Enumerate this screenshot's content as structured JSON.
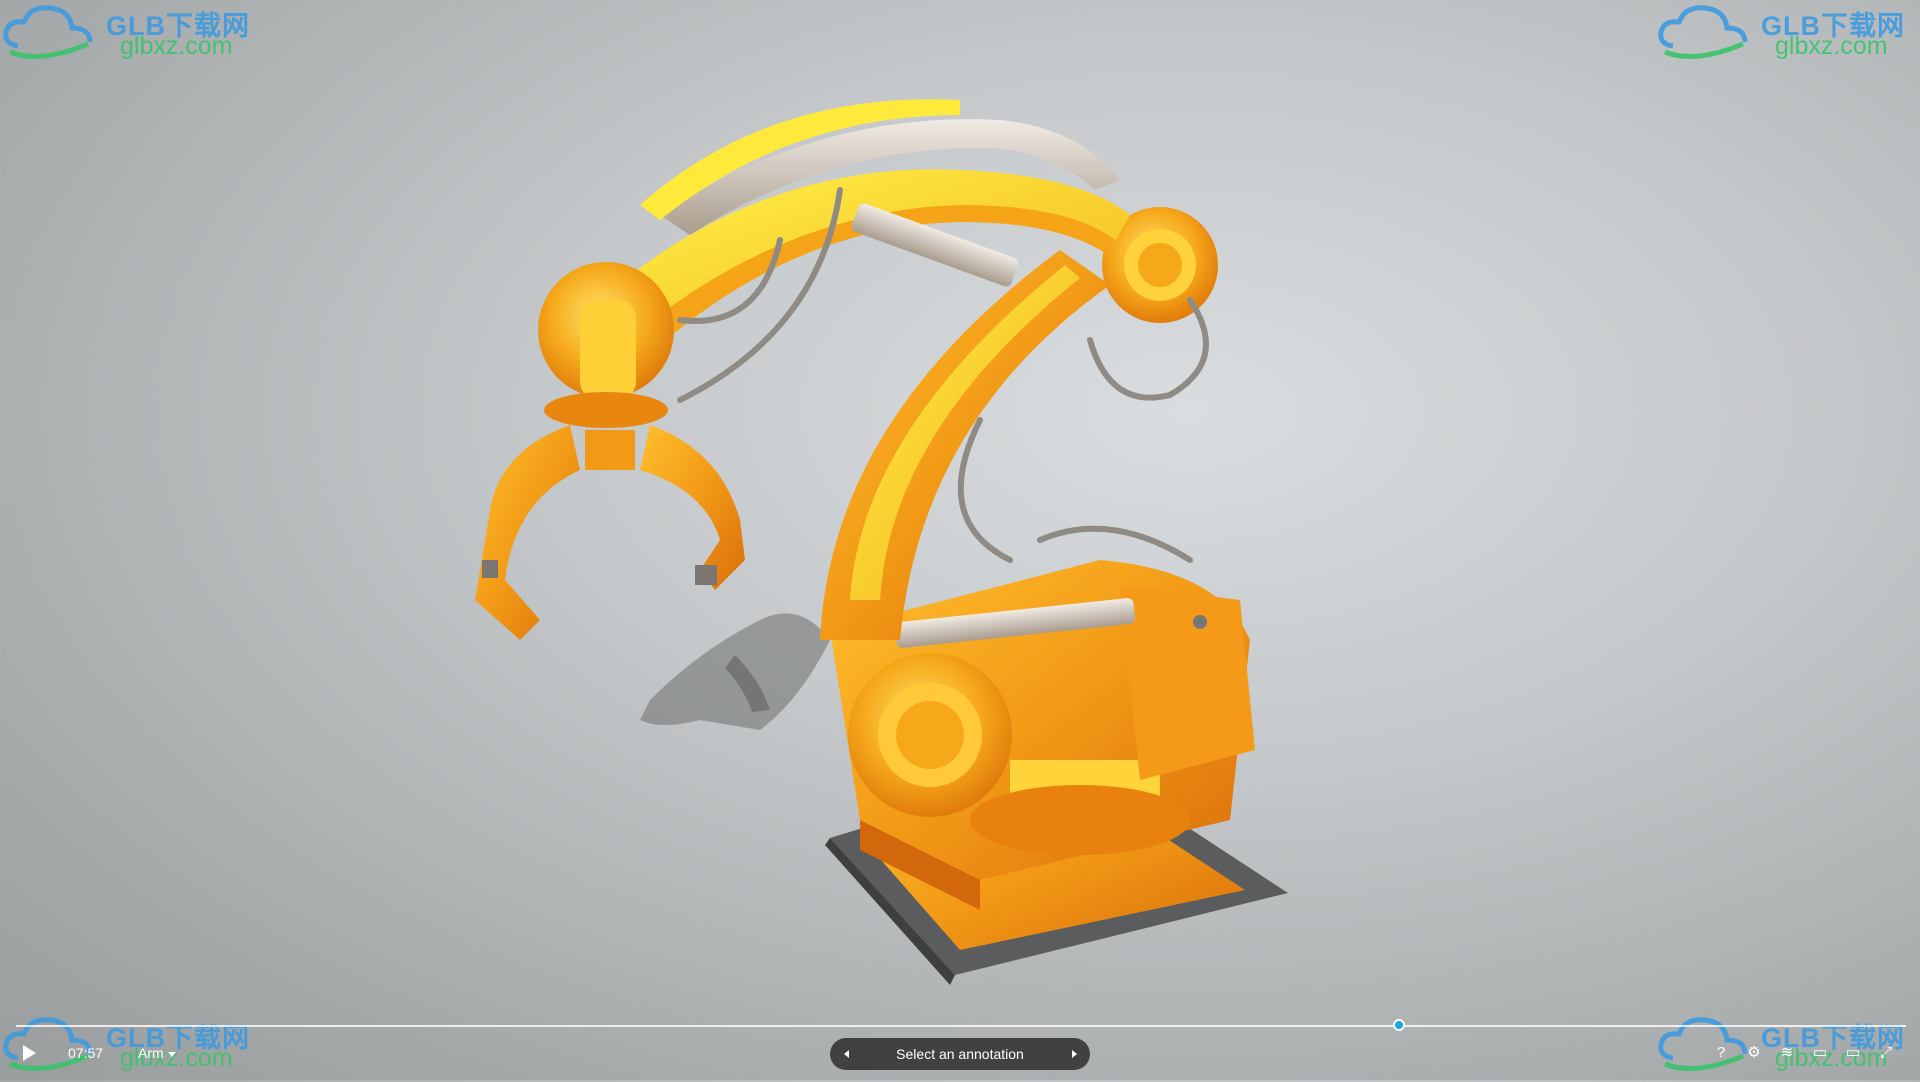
{
  "watermark": {
    "logo_text": "GLB",
    "brand": "GLB下载网",
    "domain": "glbxz.com"
  },
  "player": {
    "time": "07:57",
    "animation": "Arm",
    "timeline_progress": 0.732
  },
  "annotation": {
    "label": "Select an annotation"
  },
  "toolbar": {
    "help": "?",
    "settings": "⚙",
    "layers": "≋",
    "vr": "▭",
    "theater": "▭",
    "fullscreen": "⤢"
  },
  "colors": {
    "accent": "#1ca8dd",
    "arm_yellow": "#f5d21a",
    "arm_orange": "#f08a12",
    "watermark_blue": "#3f9be0",
    "watermark_green": "#39c46a"
  }
}
